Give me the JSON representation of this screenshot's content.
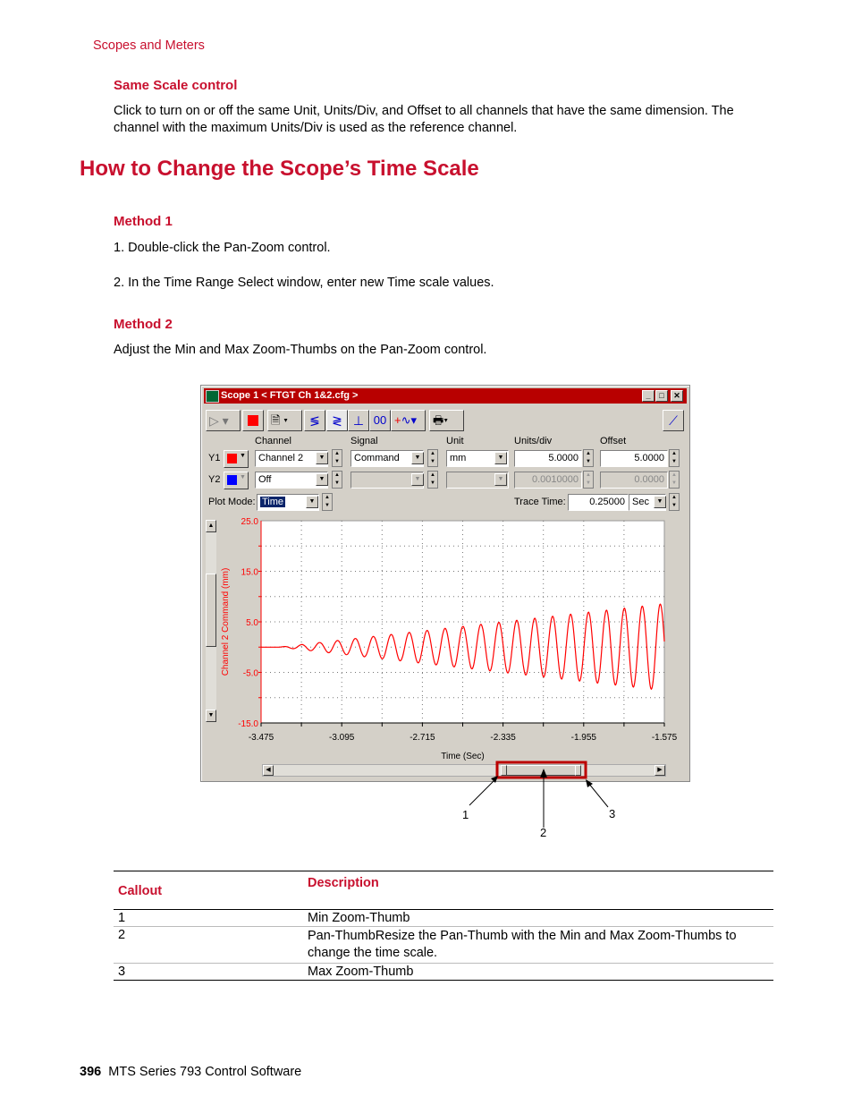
{
  "header": {
    "section": "Scopes and Meters"
  },
  "same_scale": {
    "title": "Same Scale control",
    "text": "Click to turn on or off the same Unit, Units/Div, and Offset to all channels that have the same dimension. The channel with the maximum Units/Div is used as the reference channel."
  },
  "heading": "How to Change the Scope’s Time Scale",
  "method1": {
    "title": "Method 1",
    "steps": [
      "1.  Double-click the Pan-Zoom control.",
      "2.  In the Time Range Select window, enter new Time scale values."
    ]
  },
  "method2": {
    "title": "Method 2",
    "text": "Adjust the Min and Max Zoom-Thumbs on the Pan-Zoom control."
  },
  "scope": {
    "title": "Scope  1 < FTGT Ch 1&2.cfg >",
    "columns": {
      "channel": "Channel",
      "signal": "Signal",
      "unit": "Unit",
      "units_div": "Units/div",
      "offset": "Offset"
    },
    "y1": {
      "label": "Y1",
      "color": "#ff0000",
      "channel": "Channel 2",
      "signal": "Command",
      "unit": "mm",
      "units_div": "5.0000",
      "offset": "5.0000"
    },
    "y2": {
      "label": "Y2",
      "color": "#0000ff",
      "channel": "Off",
      "signal": "",
      "unit": "",
      "units_div": "0.0010000",
      "offset": "0.0000"
    },
    "plot_mode_label": "Plot Mode:",
    "plot_mode": "Time",
    "trace_time_label": "Trace Time:",
    "trace_time": "0.25000",
    "trace_unit": "Sec",
    "chart": {
      "ylabel": "Channel 2 Command (mm)",
      "xlabel": "Time (Sec)",
      "ylim": [
        -15,
        25
      ],
      "yticks": [
        "25.0",
        "15.0",
        "5.0",
        "-5.0",
        "-15.0"
      ],
      "xticks": [
        "-3.475",
        "-3.095",
        "-2.715",
        "-2.335",
        "-1.955",
        "-1.575"
      ],
      "xlim": [
        -3.475,
        -1.575
      ],
      "trace_color": "#ff0000"
    }
  },
  "callouts": [
    "1",
    "2",
    "3"
  ],
  "table": {
    "headers": [
      "Callout",
      "Description"
    ],
    "rows": [
      [
        "1",
        "Min Zoom-Thumb"
      ],
      [
        "2",
        "Pan-ThumbResize the Pan-Thumb with the Min and Max Zoom-Thumbs to change the time scale."
      ],
      [
        "3",
        "Max Zoom-Thumb"
      ]
    ]
  },
  "footer": {
    "page": "396",
    "title": "MTS Series 793 Control Software"
  },
  "colors": {
    "accent": "#c8102e"
  }
}
